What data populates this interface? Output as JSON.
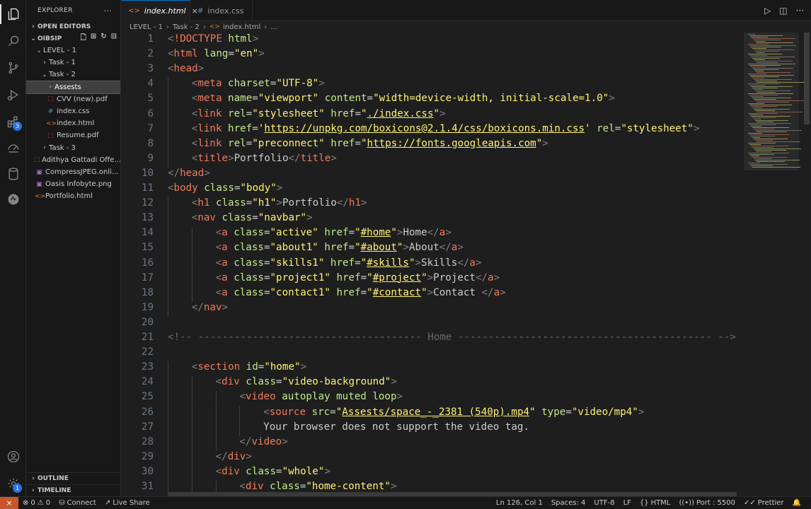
{
  "sidebar": {
    "title": "EXPLORER",
    "more": "···",
    "sections": {
      "open_editors": "OPEN EDITORS",
      "root": "OIBSIP",
      "outline": "OUTLINE",
      "timeline": "TIMELINE"
    },
    "tree": [
      {
        "label": "LEVEL - 1",
        "depth": 1,
        "kind": "folder-open"
      },
      {
        "label": "Task - 1",
        "depth": 2,
        "kind": "folder"
      },
      {
        "label": "Task - 2",
        "depth": 2,
        "kind": "folder-open"
      },
      {
        "label": "Assests",
        "depth": 3,
        "kind": "folder",
        "selected": true
      },
      {
        "label": "CVV (new).pdf",
        "depth": 3,
        "kind": "pdf"
      },
      {
        "label": "index.css",
        "depth": 3,
        "kind": "css"
      },
      {
        "label": "index.html",
        "depth": 3,
        "kind": "html"
      },
      {
        "label": "Resume.pdf",
        "depth": 3,
        "kind": "pdf"
      },
      {
        "label": "Task - 3",
        "depth": 2,
        "kind": "folder"
      },
      {
        "label": "Adithya Gattadi Offe...",
        "depth": 1,
        "kind": "pdf"
      },
      {
        "label": "CompressJPEG.onli...",
        "depth": 1,
        "kind": "img"
      },
      {
        "label": "Oasis Infobyte.png",
        "depth": 1,
        "kind": "img"
      },
      {
        "label": "Portfolio.html",
        "depth": 1,
        "kind": "html"
      }
    ]
  },
  "activity": {
    "extensions_badge": "3",
    "settings_badge": "1"
  },
  "tabs": [
    {
      "label": "index.html",
      "icon": "<>",
      "active": true,
      "close": "×"
    },
    {
      "label": "index.css",
      "icon": "#",
      "active": false
    }
  ],
  "breadcrumb": [
    "LEVEL - 1",
    "Task - 2",
    "index.html",
    "..."
  ],
  "breadcrumb_icon": "<>",
  "editor": {
    "lines": [
      {
        "n": 1,
        "ind": 0,
        "t": [
          [
            "lt",
            "<"
          ],
          [
            "tg",
            "!DOCTYPE"
          ],
          [
            "at",
            " html"
          ],
          [
            "lt",
            ">"
          ]
        ]
      },
      {
        "n": 2,
        "ind": 0,
        "t": [
          [
            "lt",
            "<"
          ],
          [
            "tg",
            "html"
          ],
          [
            "at",
            " lang"
          ],
          [
            "eq",
            "="
          ],
          [
            "st",
            "\"en\""
          ],
          [
            "lt",
            ">"
          ]
        ]
      },
      {
        "n": 3,
        "ind": 0,
        "t": [
          [
            "lt",
            "<"
          ],
          [
            "tg",
            "head"
          ],
          [
            "lt",
            ">"
          ]
        ]
      },
      {
        "n": 4,
        "ind": 1,
        "t": [
          [
            "lt",
            "<"
          ],
          [
            "tg",
            "meta"
          ],
          [
            "at",
            " charset"
          ],
          [
            "eq",
            "="
          ],
          [
            "st",
            "\"UTF-8\""
          ],
          [
            "lt",
            ">"
          ]
        ]
      },
      {
        "n": 5,
        "ind": 1,
        "t": [
          [
            "lt",
            "<"
          ],
          [
            "tg",
            "meta"
          ],
          [
            "at",
            " name"
          ],
          [
            "eq",
            "="
          ],
          [
            "st",
            "\"viewport\""
          ],
          [
            "at",
            " content"
          ],
          [
            "eq",
            "="
          ],
          [
            "st",
            "\"width=device-width, initial-scale=1.0\""
          ],
          [
            "lt",
            ">"
          ]
        ]
      },
      {
        "n": 6,
        "ind": 1,
        "t": [
          [
            "lt",
            "<"
          ],
          [
            "tg",
            "link"
          ],
          [
            "at",
            " rel"
          ],
          [
            "eq",
            "="
          ],
          [
            "st",
            "\"stylesheet\""
          ],
          [
            "at",
            " href"
          ],
          [
            "eq",
            "="
          ],
          [
            "st",
            "\""
          ],
          [
            "stu",
            "./index.css"
          ],
          [
            "st",
            "\""
          ],
          [
            "lt",
            ">"
          ]
        ]
      },
      {
        "n": 7,
        "ind": 1,
        "t": [
          [
            "lt",
            "<"
          ],
          [
            "tg",
            "link"
          ],
          [
            "at",
            " href"
          ],
          [
            "eq",
            "="
          ],
          [
            "st",
            "'"
          ],
          [
            "stu",
            "https://unpkg.com/boxicons@2.1.4/css/boxicons.min.css"
          ],
          [
            "st",
            "'"
          ],
          [
            "at",
            " rel"
          ],
          [
            "eq",
            "="
          ],
          [
            "st",
            "\"stylesheet\""
          ],
          [
            "lt",
            ">"
          ]
        ]
      },
      {
        "n": 8,
        "ind": 1,
        "t": [
          [
            "lt",
            "<"
          ],
          [
            "tg",
            "link"
          ],
          [
            "at",
            " rel"
          ],
          [
            "eq",
            "="
          ],
          [
            "st",
            "\"preconnect\""
          ],
          [
            "at",
            " href"
          ],
          [
            "eq",
            "="
          ],
          [
            "st",
            "\""
          ],
          [
            "stu",
            "https://fonts.googleapis.com"
          ],
          [
            "st",
            "\""
          ],
          [
            "lt",
            ">"
          ]
        ]
      },
      {
        "n": 9,
        "ind": 1,
        "t": [
          [
            "lt",
            "<"
          ],
          [
            "tg",
            "title"
          ],
          [
            "lt",
            ">"
          ],
          [
            "eq",
            "Portfolio"
          ],
          [
            "lt",
            "</"
          ],
          [
            "tg",
            "title"
          ],
          [
            "lt",
            ">"
          ]
        ]
      },
      {
        "n": 10,
        "ind": 0,
        "t": [
          [
            "lt",
            "</"
          ],
          [
            "tg",
            "head"
          ],
          [
            "lt",
            ">"
          ]
        ]
      },
      {
        "n": 11,
        "ind": 0,
        "t": [
          [
            "lt",
            "<"
          ],
          [
            "tg",
            "body"
          ],
          [
            "at",
            " class"
          ],
          [
            "eq",
            "="
          ],
          [
            "st",
            "\"body\""
          ],
          [
            "lt",
            ">"
          ]
        ]
      },
      {
        "n": 12,
        "ind": 1,
        "t": [
          [
            "lt",
            "<"
          ],
          [
            "tg",
            "h1"
          ],
          [
            "at",
            " class"
          ],
          [
            "eq",
            "="
          ],
          [
            "st",
            "\"h1\""
          ],
          [
            "lt",
            ">"
          ],
          [
            "eq",
            "Portfolio"
          ],
          [
            "lt",
            "</"
          ],
          [
            "tg",
            "h1"
          ],
          [
            "lt",
            ">"
          ]
        ]
      },
      {
        "n": 13,
        "ind": 1,
        "t": [
          [
            "lt",
            "<"
          ],
          [
            "tg",
            "nav"
          ],
          [
            "at",
            " class"
          ],
          [
            "eq",
            "="
          ],
          [
            "st",
            "\"navbar\""
          ],
          [
            "lt",
            ">"
          ]
        ]
      },
      {
        "n": 14,
        "ind": 2,
        "t": [
          [
            "lt",
            "<"
          ],
          [
            "tg",
            "a"
          ],
          [
            "at",
            " class"
          ],
          [
            "eq",
            "="
          ],
          [
            "st",
            "\"active\""
          ],
          [
            "at",
            " href"
          ],
          [
            "eq",
            "="
          ],
          [
            "st",
            "\""
          ],
          [
            "stu",
            "#home"
          ],
          [
            "st",
            "\""
          ],
          [
            "lt",
            ">"
          ],
          [
            "eq",
            "Home"
          ],
          [
            "lt",
            "</"
          ],
          [
            "tg",
            "a"
          ],
          [
            "lt",
            ">"
          ]
        ]
      },
      {
        "n": 15,
        "ind": 2,
        "t": [
          [
            "lt",
            "<"
          ],
          [
            "tg",
            "a"
          ],
          [
            "at",
            " class"
          ],
          [
            "eq",
            "="
          ],
          [
            "st",
            "\"about1\""
          ],
          [
            "at",
            " href"
          ],
          [
            "eq",
            "="
          ],
          [
            "st",
            "\""
          ],
          [
            "stu",
            "#about"
          ],
          [
            "st",
            "\""
          ],
          [
            "lt",
            ">"
          ],
          [
            "eq",
            "About"
          ],
          [
            "lt",
            "</"
          ],
          [
            "tg",
            "a"
          ],
          [
            "lt",
            ">"
          ]
        ]
      },
      {
        "n": 16,
        "ind": 2,
        "t": [
          [
            "lt",
            "<"
          ],
          [
            "tg",
            "a"
          ],
          [
            "at",
            " class"
          ],
          [
            "eq",
            "="
          ],
          [
            "st",
            "\"skills1\""
          ],
          [
            "at",
            " href"
          ],
          [
            "eq",
            "="
          ],
          [
            "st",
            "\""
          ],
          [
            "stu",
            "#skills"
          ],
          [
            "st",
            "\""
          ],
          [
            "lt",
            ">"
          ],
          [
            "eq",
            "Skills"
          ],
          [
            "lt",
            "</"
          ],
          [
            "tg",
            "a"
          ],
          [
            "lt",
            ">"
          ]
        ]
      },
      {
        "n": 17,
        "ind": 2,
        "t": [
          [
            "lt",
            "<"
          ],
          [
            "tg",
            "a"
          ],
          [
            "at",
            " class"
          ],
          [
            "eq",
            "="
          ],
          [
            "st",
            "\"project1\""
          ],
          [
            "at",
            " href"
          ],
          [
            "eq",
            "="
          ],
          [
            "st",
            "\""
          ],
          [
            "stu",
            "#project"
          ],
          [
            "st",
            "\""
          ],
          [
            "lt",
            ">"
          ],
          [
            "eq",
            "Project"
          ],
          [
            "lt",
            "</"
          ],
          [
            "tg",
            "a"
          ],
          [
            "lt",
            ">"
          ]
        ]
      },
      {
        "n": 18,
        "ind": 2,
        "t": [
          [
            "lt",
            "<"
          ],
          [
            "tg",
            "a"
          ],
          [
            "at",
            " class"
          ],
          [
            "eq",
            "="
          ],
          [
            "st",
            "\"contact1\""
          ],
          [
            "at",
            " href"
          ],
          [
            "eq",
            "="
          ],
          [
            "st",
            "\""
          ],
          [
            "stu",
            "#contact"
          ],
          [
            "st",
            "\""
          ],
          [
            "lt",
            ">"
          ],
          [
            "eq",
            "Contact "
          ],
          [
            "lt",
            "</"
          ],
          [
            "tg",
            "a"
          ],
          [
            "lt",
            ">"
          ]
        ]
      },
      {
        "n": 19,
        "ind": 1,
        "t": [
          [
            "lt",
            "</"
          ],
          [
            "tg",
            "nav"
          ],
          [
            "lt",
            ">"
          ]
        ]
      },
      {
        "n": 20,
        "ind": 0,
        "t": []
      },
      {
        "n": 21,
        "ind": 0,
        "t": [
          [
            "cm",
            "<!-- ------------------------------------- Home ------------------------------------------ -->"
          ]
        ]
      },
      {
        "n": 22,
        "ind": 0,
        "t": []
      },
      {
        "n": 23,
        "ind": 1,
        "t": [
          [
            "lt",
            "<"
          ],
          [
            "tg",
            "section"
          ],
          [
            "at",
            " id"
          ],
          [
            "eq",
            "="
          ],
          [
            "st",
            "\"home\""
          ],
          [
            "lt",
            ">"
          ]
        ]
      },
      {
        "n": 24,
        "ind": 2,
        "t": [
          [
            "lt",
            "<"
          ],
          [
            "tg",
            "div"
          ],
          [
            "at",
            " class"
          ],
          [
            "eq",
            "="
          ],
          [
            "st",
            "\"video-background\""
          ],
          [
            "lt",
            ">"
          ]
        ]
      },
      {
        "n": 25,
        "ind": 3,
        "t": [
          [
            "lt",
            "<"
          ],
          [
            "tg",
            "video"
          ],
          [
            "at",
            " autoplay muted loop"
          ],
          [
            "lt",
            ">"
          ]
        ]
      },
      {
        "n": 26,
        "ind": 4,
        "t": [
          [
            "lt",
            "<"
          ],
          [
            "tg",
            "source"
          ],
          [
            "at",
            " src"
          ],
          [
            "eq",
            "="
          ],
          [
            "st",
            "\""
          ],
          [
            "stu",
            "Assests/space_-_2381 (540p).mp4"
          ],
          [
            "st",
            "\""
          ],
          [
            "at",
            " type"
          ],
          [
            "eq",
            "="
          ],
          [
            "st",
            "\"video/mp4\""
          ],
          [
            "lt",
            ">"
          ]
        ]
      },
      {
        "n": 27,
        "ind": 4,
        "t": [
          [
            "eq",
            "Your browser does not support the video tag."
          ]
        ]
      },
      {
        "n": 28,
        "ind": 3,
        "t": [
          [
            "lt",
            "</"
          ],
          [
            "tg",
            "video"
          ],
          [
            "lt",
            ">"
          ]
        ]
      },
      {
        "n": 29,
        "ind": 2,
        "t": [
          [
            "lt",
            "</"
          ],
          [
            "tg",
            "div"
          ],
          [
            "lt",
            ">"
          ]
        ]
      },
      {
        "n": 30,
        "ind": 2,
        "t": [
          [
            "lt",
            "<"
          ],
          [
            "tg",
            "div"
          ],
          [
            "at",
            " class"
          ],
          [
            "eq",
            "="
          ],
          [
            "st",
            "\"whole\""
          ],
          [
            "lt",
            ">"
          ]
        ]
      },
      {
        "n": 31,
        "ind": 3,
        "t": [
          [
            "lt",
            "<"
          ],
          [
            "tg",
            "div"
          ],
          [
            "at",
            " class"
          ],
          [
            "eq",
            "="
          ],
          [
            "st",
            "\"home-content\""
          ],
          [
            "lt",
            ">"
          ]
        ]
      }
    ]
  },
  "statusbar": {
    "errors": "0",
    "warnings": "0",
    "connect": "Connect",
    "live_share": "Live Share",
    "position": "Ln 126, Col 1",
    "spaces": "Spaces: 4",
    "encoding": "UTF-8",
    "eol": "LF",
    "language": "HTML",
    "port": "Port : 5500",
    "prettier": "Prettier"
  },
  "colors": {
    "tag": "#f07a5b",
    "attr": "#c3e88d",
    "string": "#fff176",
    "comment": "#6a6a6a",
    "remote": "#c8562a",
    "accent": "#0078d4"
  }
}
